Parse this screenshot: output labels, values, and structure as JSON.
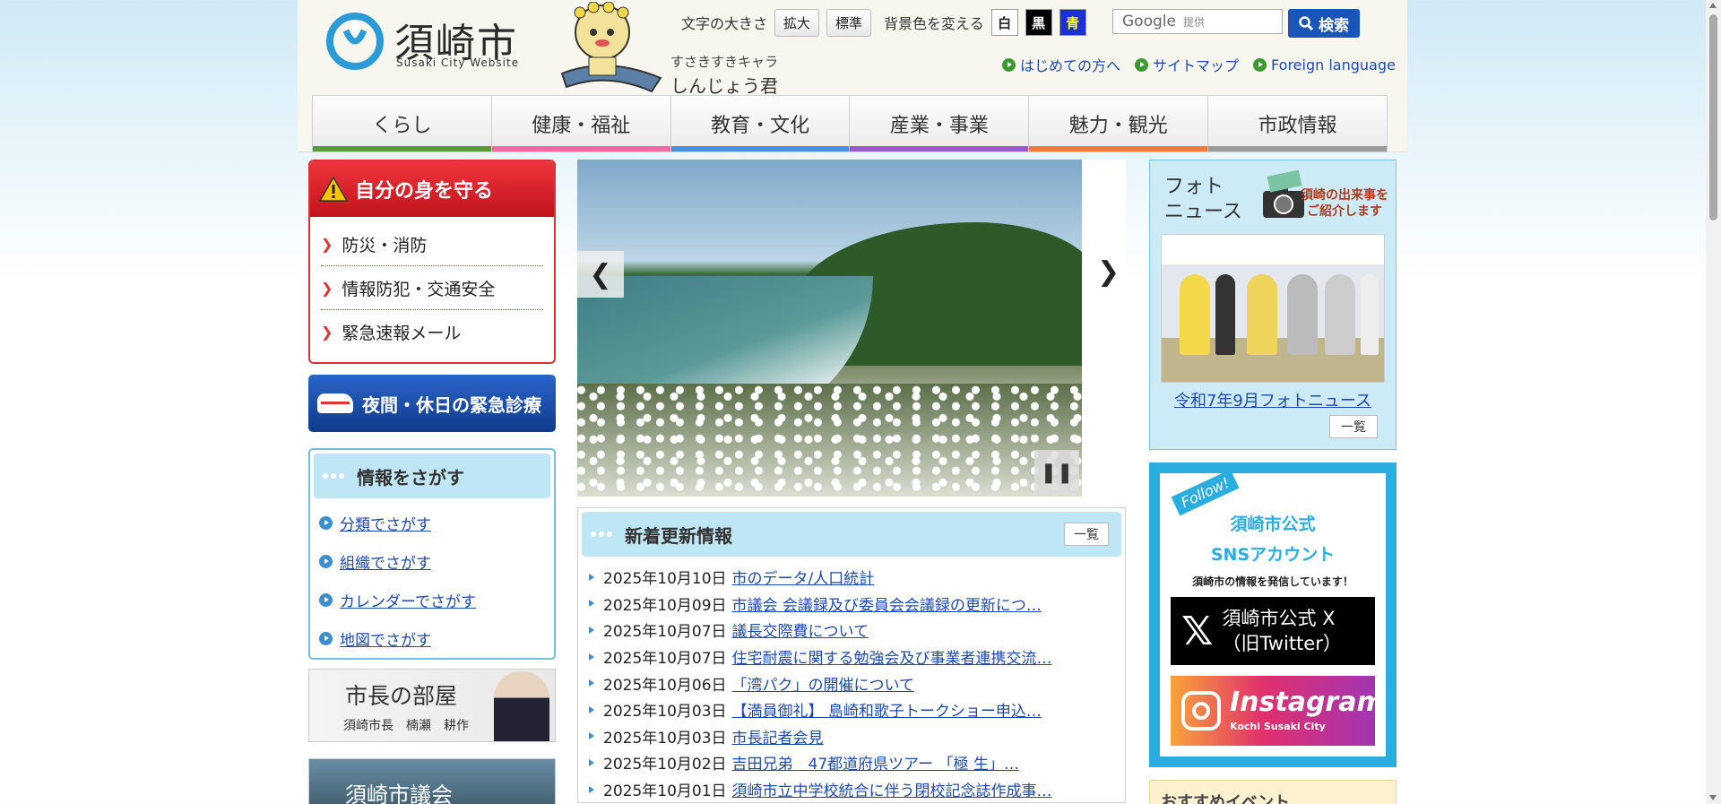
{
  "header": {
    "logo_title": "須崎市",
    "logo_sub": "Susaki City Website",
    "mascot_caption1": "すさきすきキャラ",
    "mascot_caption2": "しんじょう君",
    "font_size_label": "文字の大きさ",
    "enlarge": "拡大",
    "standard": "標準",
    "bg_label": "背景色を変える",
    "bg_white": "白",
    "bg_black": "黒",
    "bg_blue": "青",
    "search_google": "Google",
    "search_placeholder": "提供",
    "search_button": "検索",
    "links": [
      "はじめての方へ",
      "サイトマップ",
      "Foreign language"
    ]
  },
  "nav": [
    {
      "label": "くらし",
      "color": "#5a9a3a"
    },
    {
      "label": "健康・福祉",
      "color": "#f06aa0"
    },
    {
      "label": "教育・文化",
      "color": "#4a8fe0"
    },
    {
      "label": "産業・事業",
      "color": "#9a5cc8"
    },
    {
      "label": "魅力・観光",
      "color": "#f07a3a"
    },
    {
      "label": "市政情報",
      "color": "#9a9a9a"
    }
  ],
  "left": {
    "protect_title": "自分の身を守る",
    "protect_items": [
      "防災・消防",
      "情報防犯・交通安全",
      "緊急速報メール"
    ],
    "emergency": "夜間・休日の緊急診療",
    "search_title": "情報をさがす",
    "search_items": [
      "分類でさがす",
      "組織でさがす",
      "カレンダーでさがす",
      "地図でさがす"
    ],
    "mayor_title": "市長の部屋",
    "mayor_sub": "須崎市長　楠瀬　耕作",
    "council": "須崎市議会"
  },
  "slider": {
    "prev": "❮",
    "next": "❯",
    "pause": "❚❚"
  },
  "news": {
    "title": "新着更新情報",
    "list_button": "一覧",
    "items": [
      {
        "date": "2025年10月10日",
        "text": "市のデータ/人口統計"
      },
      {
        "date": "2025年10月09日",
        "text": "市議会 会議録及び委員会会議録の更新につ…"
      },
      {
        "date": "2025年10月07日",
        "text": "議長交際費について"
      },
      {
        "date": "2025年10月07日",
        "text": "住宅耐震に関する勉強会及び事業者連携交流…"
      },
      {
        "date": "2025年10月06日",
        "text": "「湾パク」の開催について"
      },
      {
        "date": "2025年10月03日",
        "text": "【満員御礼】 島崎和歌子トークショー申込…"
      },
      {
        "date": "2025年10月03日",
        "text": "市長記者会見"
      },
      {
        "date": "2025年10月02日",
        "text": "吉田兄弟　47都道府県ツアー 「極 生」…"
      },
      {
        "date": "2025年10月01日",
        "text": "須崎市立中学校統合に伴う閉校記念誌作成事…"
      }
    ]
  },
  "right": {
    "photo_title_1": "フォト",
    "photo_title_2": "ニュース",
    "photo_tag_1": "須崎の出来事を",
    "photo_tag_2": "ご紹介します",
    "photo_caption": "令和7年9月フォトニュース",
    "photo_list": "一覧",
    "sns_follow": "Follow!",
    "sns_title_1": "須崎市公式",
    "sns_title_2": "SNSアカウント",
    "sns_sub": "須崎市の情報を発信しています！",
    "x_label_1": "須崎市公式 X",
    "x_label_2": "（旧Twitter）",
    "ig_label": "Instagram",
    "ig_sub": "Kochi Susaki City",
    "event_title": "おすすめイベント"
  }
}
